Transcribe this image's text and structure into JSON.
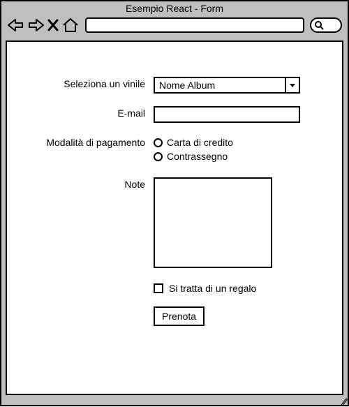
{
  "window": {
    "title": "Esempio React - Form"
  },
  "form": {
    "labels": {
      "vinyl": "Seleziona un vinile",
      "email": "E-mail",
      "payment": "Modalità di pagamento",
      "notes": "Note"
    },
    "vinyl_selected": "Nome Album",
    "email_value": "",
    "payment_options": {
      "credit": "Carta di credito",
      "cod": "Contrassegno"
    },
    "notes_value": "",
    "gift_label": "Si tratta di un regalo",
    "submit_label": "Prenota"
  }
}
